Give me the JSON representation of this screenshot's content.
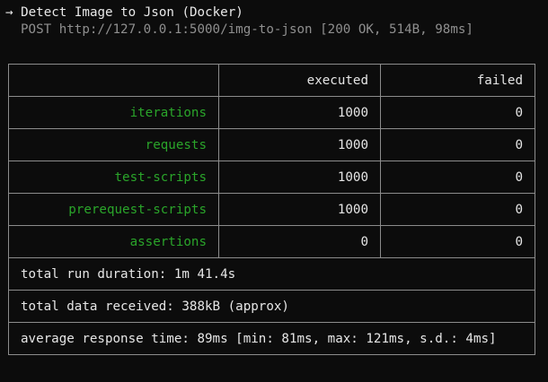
{
  "header": {
    "arrow": "→",
    "title": "Detect Image to Json (Docker)",
    "request": "POST http://127.0.0.1:5000/img-to-json [200 OK, 514B, 98ms]"
  },
  "table": {
    "columns": [
      "",
      "executed",
      "failed"
    ],
    "rows": [
      {
        "label": "iterations",
        "executed": "1000",
        "failed": "0"
      },
      {
        "label": "requests",
        "executed": "1000",
        "failed": "0"
      },
      {
        "label": "test-scripts",
        "executed": "1000",
        "failed": "0"
      },
      {
        "label": "prerequest-scripts",
        "executed": "1000",
        "failed": "0"
      },
      {
        "label": "assertions",
        "executed": "0",
        "failed": "0"
      }
    ],
    "summary": [
      "total run duration: 1m 41.4s",
      "total data received: 388kB (approx)",
      "average response time: 89ms [min: 81ms, max: 121ms, s.d.: 4ms]"
    ]
  },
  "colors": {
    "background": "#0c0c0c",
    "text": "#e6e6e6",
    "muted": "#8f8f8f",
    "label_green": "#2aa52a",
    "border": "#8c8c8c"
  }
}
